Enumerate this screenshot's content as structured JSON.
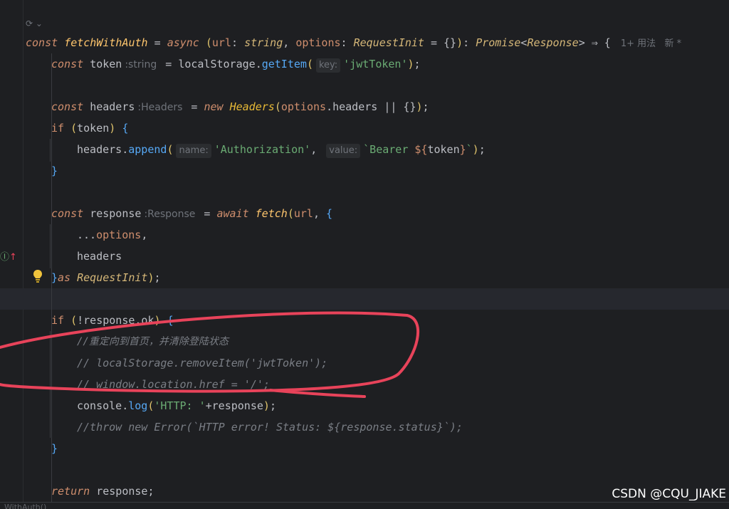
{
  "editor": {
    "top_hint": "⟳ ⌄",
    "usage_hint": "1+ 用法   新 *",
    "hints": {
      "token_type": ":string",
      "key": "key:",
      "headers_type": ":Headers",
      "name": "name:",
      "value": "value:",
      "response_type": ":Response"
    },
    "code": {
      "l1_const": "const",
      "l1_fn": "fetchWithAuth",
      "l1_eq": " = ",
      "l1_async": "async",
      "l1_url": "url",
      "l1_string": "string",
      "l1_options": "options",
      "l1_reqinit": "RequestInit",
      "l1_tail": " = {}",
      "l1_promise": "Promise",
      "l1_response": "Response",
      "l1_arrow": " ⇒ {",
      "l2_const": "const",
      "l2_token": "token",
      "l2_ls": "localStorage",
      "l2_getitem": "getItem",
      "l2_str": "'jwtToken'",
      "l4_headers": "headers",
      "l4_new": "new",
      "l4_cls": "Headers",
      "l4_options": "options",
      "l4_headers2": "headers",
      "l4_tail": " || {}",
      "l5_if": "if",
      "l5_token": "token",
      "l6_headers": "headers",
      "l6_append": "append",
      "l6_auth": "'Authorization'",
      "l6_bearer": "`Bearer ",
      "l6_interp_open": "${",
      "l6_token": "token",
      "l6_interp_close": "}",
      "l6_tick": "`",
      "l7_close": "}",
      "l9_response": "response",
      "l9_await": "await",
      "l9_fetch": "fetch",
      "l9_url": "url",
      "l10_spread": "...",
      "l10_options": "options",
      "l11_headers": "headers",
      "l12_close": "}",
      "l12_as": "as",
      "l12_reqinit": "RequestInit",
      "l14_if": "if",
      "l14_cond": "!response.ok",
      "c1": "//重定向到首页，并清除登陆状态",
      "c2": "// localStorage.removeItem('jwtToken');",
      "c3": "// window.location.href = '/';",
      "l18_console": "console",
      "l18_log": "log",
      "l18_str": "'HTTP: '",
      "l18_tail": "+response",
      "c4": "//throw new Error(`HTTP error! Status: ${response.status}`);",
      "l20_close": "}",
      "l22_return": "return",
      "l22_response": "response"
    },
    "bottom_text": "WithAuth()",
    "watermark": "CSDN @CQU_JIAKE"
  },
  "colors": {
    "background": "#1e1f22",
    "keyword": "#cf8e6d",
    "string": "#6aab73",
    "comment": "#7a7e85",
    "annotation": "#e8435a"
  }
}
